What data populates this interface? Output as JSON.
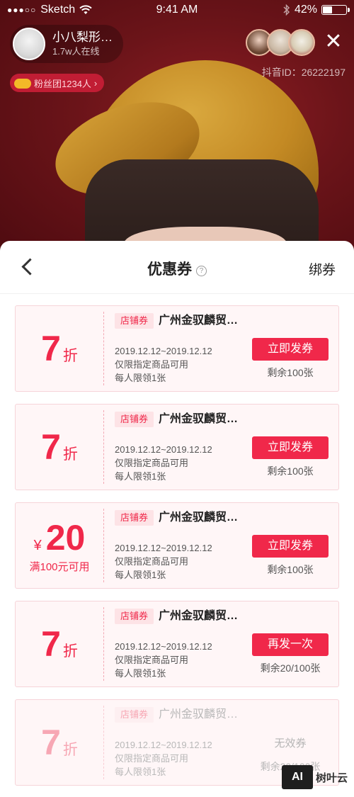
{
  "status_bar": {
    "carrier": "Sketch",
    "time": "9:41 AM",
    "battery": "42%",
    "battery_level": 0.42
  },
  "live": {
    "host_name": "小八梨形…",
    "online_count": "1.7w人在线",
    "douyin_id": "抖音ID：26222197",
    "fans_badge": "粉丝团1234人"
  },
  "sheet": {
    "title": "优惠券",
    "bind_label": "绑券"
  },
  "coupons": [
    {
      "value": "7",
      "unit": "折",
      "tag": "店铺券",
      "shop": "广州金驭麟贸…",
      "date": "2019.12.12~2019.12.12",
      "scope": "仅限指定商品可用",
      "limit": "每人限领1张",
      "button": "立即发券",
      "remain": "剩余100张"
    },
    {
      "value": "7",
      "unit": "折",
      "tag": "店铺券",
      "shop": "广州金驭麟贸…",
      "date": "2019.12.12~2019.12.12",
      "scope": "仅限指定商品可用",
      "limit": "每人限领1张",
      "button": "立即发券",
      "remain": "剩余100张"
    },
    {
      "currency": "¥",
      "value": "20",
      "condition": "满100元可用",
      "tag": "店铺券",
      "shop": "广州金驭麟贸…",
      "date": "2019.12.12~2019.12.12",
      "scope": "仅限指定商品可用",
      "limit": "每人限领1张",
      "button": "立即发券",
      "remain": "剩余100张"
    },
    {
      "value": "7",
      "unit": "折",
      "tag": "店铺券",
      "shop": "广州金驭麟贸…",
      "date": "2019.12.12~2019.12.12",
      "scope": "仅限指定商品可用",
      "limit": "每人限领1张",
      "button": "再发一次",
      "remain": "剩余20/100张"
    },
    {
      "value": "7",
      "unit": "折",
      "tag": "店铺券",
      "shop": "广州金驭麟贸…",
      "date": "2019.12.12~2019.12.12",
      "scope": "仅限指定商品可用",
      "limit": "每人限领1张",
      "status": "无效券",
      "remain": "剩余20/100张"
    }
  ],
  "watermark": {
    "logo": "AI",
    "text": "树叶云"
  },
  "colors": {
    "accent": "#f0284a",
    "coupon_bg": "#fff6f7",
    "disabled": "#f7a7b4"
  }
}
